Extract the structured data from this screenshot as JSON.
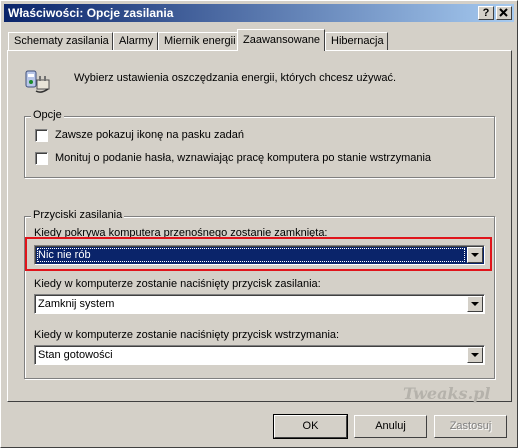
{
  "window": {
    "title": "Właściwości: Opcje zasilania"
  },
  "title_buttons": {
    "help": "?",
    "close": "X"
  },
  "tabs": [
    {
      "label": "Schematy zasilania"
    },
    {
      "label": "Alarmy"
    },
    {
      "label": "Miernik energii"
    },
    {
      "label": "Zaawansowane",
      "active": true
    },
    {
      "label": "Hibernacja"
    }
  ],
  "intro_text": "Wybierz ustawienia oszczędzania energii, których chcesz używać.",
  "options_group": {
    "label": "Opcje",
    "checkboxes": [
      {
        "label": "Zawsze pokazuj ikonę na pasku zadań",
        "checked": false
      },
      {
        "label": "Monituj o podanie hasła, wznawiając pracę komputera po stanie wstrzymania",
        "checked": false
      }
    ]
  },
  "power_buttons_group": {
    "label": "Przyciski zasilania",
    "lid_label": "Kiedy pokrywa komputera przenośnego zostanie zamknięta:",
    "lid_value": "Nic nie rób",
    "power_label": "Kiedy w komputerze zostanie naciśnięty przycisk zasilania:",
    "power_value": "Zamknij system",
    "sleep_label": "Kiedy w komputerze zostanie naciśnięty przycisk wstrzymania:",
    "sleep_value": "Stan gotowości"
  },
  "watermark": "Tweaks.pl",
  "buttons": {
    "ok": "OK",
    "cancel": "Anuluj",
    "apply": "Zastosuj"
  },
  "colors": {
    "titlebar": "#0a246a",
    "selection": "#0a246a",
    "highlight_box": "#e0141b"
  }
}
